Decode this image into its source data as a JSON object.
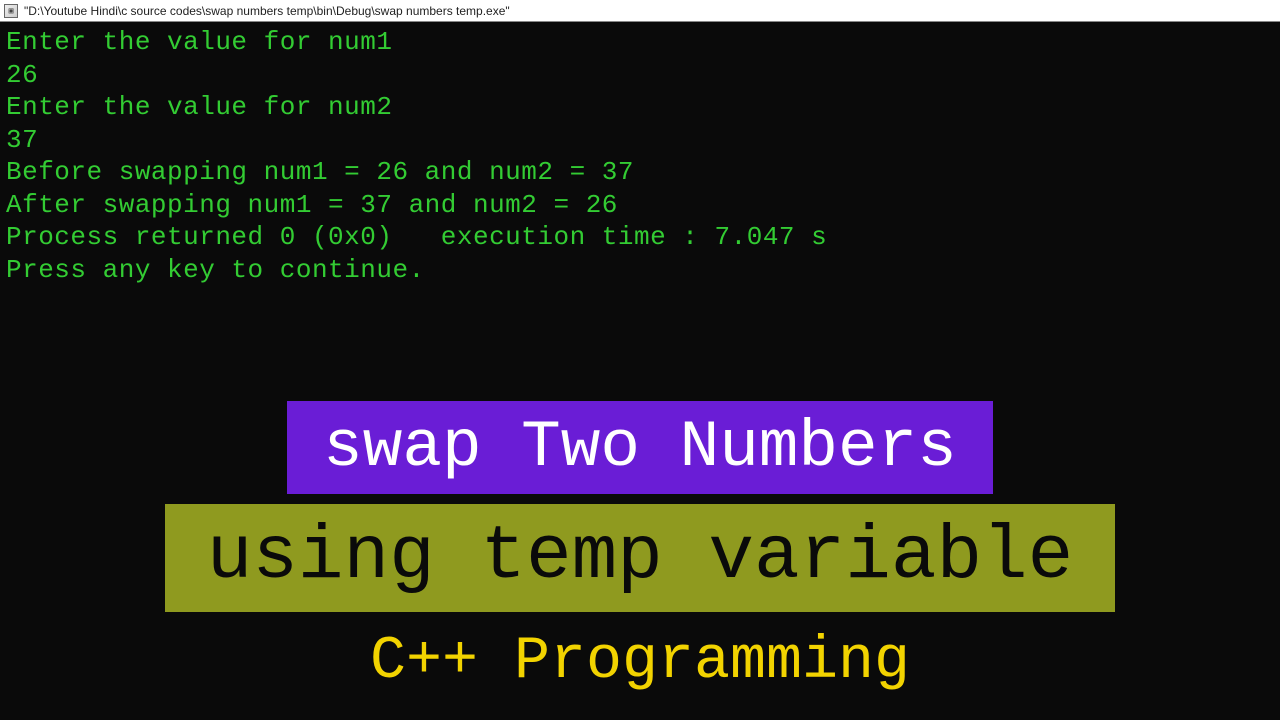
{
  "window": {
    "title": "\"D:\\Youtube Hindi\\c source codes\\swap numbers temp\\bin\\Debug\\swap numbers temp.exe\""
  },
  "console": {
    "lines": [
      "Enter the value for num1",
      "26",
      "Enter the value for num2",
      "37",
      "Before swapping num1 = 26 and num2 = 37",
      "After swapping num1 = 37 and num2 = 26",
      "Process returned 0 (0x0)   execution time : 7.047 s",
      "Press any key to continue."
    ]
  },
  "overlay": {
    "band1": "swap Two Numbers",
    "band2": "using temp variable",
    "band3": "C++ Programming"
  },
  "colors": {
    "console_fg": "#33cc33",
    "console_bg": "#0a0a0a",
    "band1_bg": "#6a1dd6",
    "band1_fg": "#ffffff",
    "band2_bg": "#8f9a1f",
    "band2_fg": "#0a0a0a",
    "band3_bg": "#0a0a0a",
    "band3_fg": "#f2d300"
  }
}
